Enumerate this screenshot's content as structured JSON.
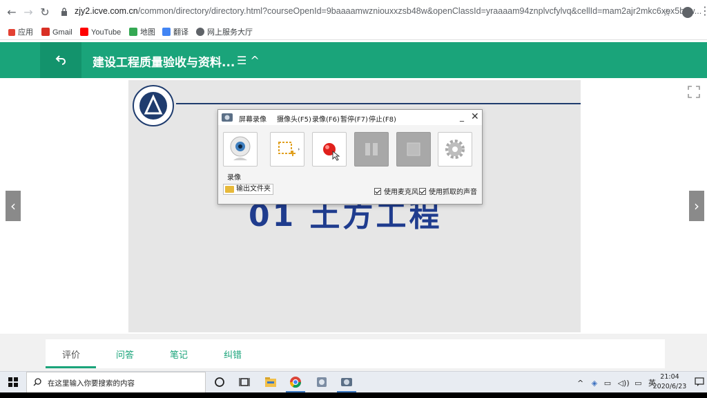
{
  "browser": {
    "url_host": "zjy2.icve.com.cn",
    "url_rest": "/common/directory/directory.html?courseOpenId=9baaaamwzniouxxzsb48w&openClassId=yraaaam94znplvcfylvq&cellId=mam2ajr2mkc6xex5bcw...",
    "bookmarks": [
      {
        "label": "应用",
        "color": "#e34133"
      },
      {
        "label": "Gmail",
        "color": "#d93025"
      },
      {
        "label": "YouTube",
        "color": "#ff0000"
      },
      {
        "label": "地图",
        "color": "#34a853"
      },
      {
        "label": "翻译",
        "color": "#4285f4"
      },
      {
        "label": "网上服务大厅",
        "color": "#5f6368"
      }
    ]
  },
  "header": {
    "course_title": "建设工程质量验收与资料...",
    "menu_toggle": "☰ ^"
  },
  "slide": {
    "title": "01 土方工程"
  },
  "recorder": {
    "title": "屏幕录像",
    "menu": [
      "摄像头(F5)",
      "录像(F6)",
      "暂停(F7)",
      "停止(F8)"
    ],
    "camera_label": "录像",
    "output_folder": "输出文件夹",
    "checks": [
      {
        "label": "使用麦克风",
        "checked": true
      },
      {
        "label": "使用抓取的声音",
        "checked": true
      }
    ]
  },
  "tabs": [
    {
      "label": "评价",
      "active": true
    },
    {
      "label": "问答",
      "active": false
    },
    {
      "label": "笔记",
      "active": false
    },
    {
      "label": "纠错",
      "active": false
    }
  ],
  "taskbar": {
    "search_placeholder": "在这里输入你要搜索的内容",
    "ime": "英",
    "time": "21:04",
    "date": "2020/6/23"
  },
  "colors": {
    "brand_green": "#1aa47a",
    "slide_title_blue": "#1f3c8e"
  }
}
